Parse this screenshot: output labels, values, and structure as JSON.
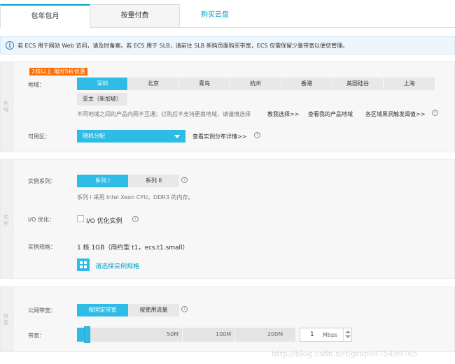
{
  "tabs": [
    {
      "label": "包年包月"
    },
    {
      "label": "按量付费"
    },
    {
      "label": "购买云盘"
    }
  ],
  "notice": {
    "icon": "info-icon",
    "text": "若 ECS 用于网站 Web 访问，请及时备案。若 ECS 用于 SLB，请前往 SLB 新购页面购买带宽，ECS 仅需保留少量带宽以便您管理。"
  },
  "region_section": {
    "side_label": "地域",
    "promo": "2核以上 限时5折优惠",
    "region_label": "地域：",
    "regions": [
      "深圳",
      "北京",
      "青岛",
      "杭州",
      "香港",
      "美国硅谷",
      "上海",
      "亚太（新加坡）"
    ],
    "selected_region": "深圳",
    "hint": "不同地域之间的产品内网不互通；订购后不支持更换地域，请谨慎选择",
    "link_teach": "教我选择>>",
    "link_my_regions": "查看我的产品地域",
    "link_blackhole": "各区域黑洞触发阈值>>",
    "zone_label": "可用区：",
    "zone_value": "随机分配",
    "zone_link": "查看实例分布详情>>"
  },
  "instance_section": {
    "side_label": "实例",
    "series_label": "实例系列：",
    "series": [
      "系列 I",
      "系列 II"
    ],
    "selected_series": "系列 I",
    "series_hint": "系列 I 采用 Intel Xeon CPU，DDR3 的内存。",
    "io_label": "I/O 优化：",
    "io_checkbox_label": "I/O 优化实例",
    "spec_label": "实例规格：",
    "spec_value": "1 核 1GB（简约型 t1，ecs.t1.small）",
    "spec_link": "请选择实例规格"
  },
  "bandwidth_section": {
    "side_label": "带宽",
    "type_label": "公网带宽：",
    "types": [
      "按固定带宽",
      "按使用流量"
    ],
    "selected_type": "按固定带宽",
    "bw_label": "带宽：",
    "marks": [
      "50M",
      "100M",
      "200M"
    ],
    "value": "1",
    "unit": "Mbps",
    "level_fraction": 0.005
  },
  "watermark": "http://blog.csdn.net/grapo875499765",
  "colors": {
    "accent": "#2ebbe5",
    "promo": "#ff6a00",
    "link": "#00a2ca",
    "notice_bg": "#edf6fc"
  }
}
